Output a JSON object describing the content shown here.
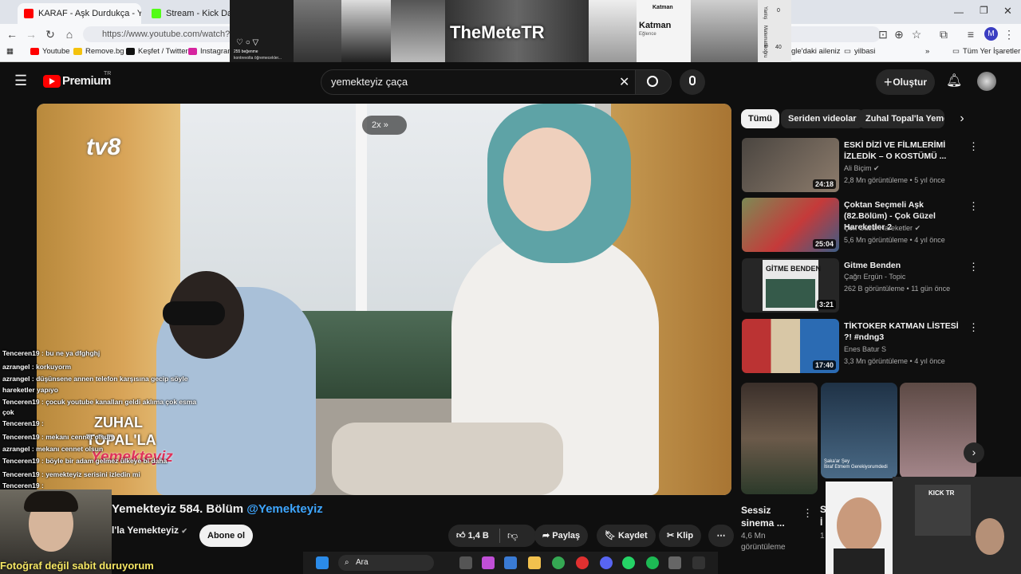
{
  "browser": {
    "tabs": [
      {
        "label": "KARAF - Aşk Durdukça - YouTu",
        "icon": "youtube-favicon"
      },
      {
        "label": "Stream - Kick Dashboa",
        "icon": "kick-favicon"
      }
    ],
    "url": "https://www.youtube.com/watch?v=y",
    "bookmarks": [
      "Youtube",
      "Remove.bg",
      "Keşfet / Twitter",
      "Instagram"
    ],
    "bookmarks_right": [
      "gle'daki aileniz",
      "yilbasi",
      "Tüm Yer İşaretleri"
    ],
    "profile_initial": "M"
  },
  "stream_overlay": {
    "channel_name": "TheMeteTR",
    "post_caption_1": "255 beğenme",
    "post_caption_2": "kontrevolta öğremecekler...",
    "card_title": "Katman",
    "card_title_2": "Katman",
    "card_sub": "Eğlence",
    "side_label_1": "Yanlış",
    "side_label_2": "Matematik",
    "side_label_3": "Doğru",
    "side_value_1": "0",
    "side_value_2": "40"
  },
  "youtube": {
    "logo_text": "Premium",
    "logo_badge": "TR",
    "search_query": "yemekteyiz çaça",
    "create_label": "Oluştur",
    "colors": {
      "accent": "#ff0000",
      "link": "#3ea6ff",
      "background": "#0f0f0f"
    }
  },
  "video": {
    "speed_badge": "2x",
    "channel_logo": "tv8",
    "program_logo_1": "ZUHAL",
    "program_logo_2": "TOPAL'LA",
    "program_logo_3": "Yemekteyiz",
    "title": "Yemekteyiz 584. Bölüm",
    "title_handle": "@Yemekteyiz",
    "channel": "l'la Yemekteyiz",
    "subscribe_label": "Abone ol",
    "like_count": "1,4 B",
    "share_label": "Paylaş",
    "save_label": "Kaydet",
    "clip_label": "Klip"
  },
  "chat": [
    {
      "user": "Tenceren19",
      "msg": ": bu ne ya dfghghj"
    },
    {
      "user": "azrangel",
      "msg": ": korkuyorm"
    },
    {
      "user": "azrangel",
      "msg": ": düşünsene annen telefon karşısına gecip söyle"
    },
    {
      "user": "",
      "msg": "hareketler yapıyo"
    },
    {
      "user": "Tenceren19",
      "msg": ": çocuk youtube kanalları geldi aklıma çok esma"
    },
    {
      "user": "",
      "msg": "çok"
    },
    {
      "user": "Tenceren19",
      "msg": ":"
    },
    {
      "user": "Tenceren19",
      "msg": ": mekanı cennet olsun"
    },
    {
      "user": "azrangel",
      "msg": ": mekanı cennet olsun"
    },
    {
      "user": "Tenceren19",
      "msg": ": böyle bir adam gelmez ülkeye bi daha"
    },
    {
      "user": "Tenceren19",
      "msg": ": yemekteyiz serisini izledin mi"
    },
    {
      "user": "Tenceren19",
      "msg": ":"
    }
  ],
  "webcam_caption": "Fotoğraf değil sabit duruyorum",
  "kick_label": "KICK TR",
  "chips": [
    "Tümü",
    "Seriden videolar",
    "Zuhal Topal'la Yemek"
  ],
  "recommendations": [
    {
      "title": "ESKİ DİZİ VE FİLMLERİMİ İZLEDİK – O KOSTÜMÜ ...",
      "channel": "Ali Biçim",
      "verified": true,
      "meta": "2,8 Mn görüntüleme • 5 yıl önce",
      "duration": "24:18"
    },
    {
      "title": "Çoktan Seçmeli Aşk (82.Bölüm) - Çok Güzel Hareketler 2",
      "channel": "Çok Güzel Hareketler",
      "verified": true,
      "meta": "5,6 Mn görüntüleme • 4 yıl önce",
      "duration": "25:04"
    },
    {
      "title": "Gitme Benden",
      "channel": "Çağrı Ergün - Topic",
      "verified": false,
      "meta": "262 B görüntüleme • 11 gün önce",
      "duration": "3:21",
      "thumb_text": "GİTME BENDEN"
    },
    {
      "title": "TİKTOKER KATMAN LİSTESİ ?! #ndng3",
      "channel": "Enes Batur S",
      "verified": false,
      "meta": "3,3 Mn görüntüleme • 4 yıl önce",
      "duration": "17:40"
    }
  ],
  "shorts": {
    "caption": "Şaka'ar Şey\nİtiraf Etmem Gerekiyorumdedi",
    "title": "Sessiz sinema ...",
    "views": "4,6 Mn",
    "views_suffix": "görüntüleme",
    "title_2": "S",
    "title_2b": "İ",
    "views_2": "1"
  },
  "taskbar": {
    "search_label": "Ara"
  }
}
